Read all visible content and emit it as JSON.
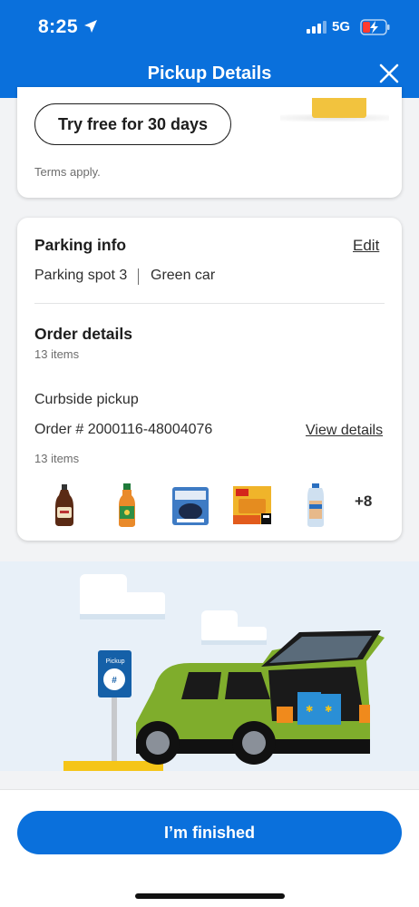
{
  "status_bar": {
    "time": "8:25",
    "network": "5G"
  },
  "header": {
    "title": "Pickup Details",
    "close_icon": "close-icon"
  },
  "promo": {
    "button_label": "Try free for 30 days",
    "terms": "Terms apply."
  },
  "parking": {
    "heading": "Parking info",
    "edit_label": "Edit",
    "spot": "Parking spot 3",
    "separator": "|",
    "car": "Green car"
  },
  "order": {
    "heading": "Order details",
    "count": "13 items",
    "method": "Curbside pickup",
    "number": "Order # 2000116-48004076",
    "view_label": "View details",
    "count_repeat": "13 items",
    "items": [
      "syrup-bottle",
      "dressing-bottle",
      "bag-product",
      "waffles-box",
      "bread-loaf"
    ],
    "more": "+8"
  },
  "illustration": {
    "sign_label": "Pickup",
    "sign_symbol": "#"
  },
  "footer": {
    "finish_label": "I’m finished"
  },
  "colors": {
    "brand_blue": "#0a70dc",
    "car_green": "#7fad2c",
    "sign_blue": "#1560a8"
  }
}
